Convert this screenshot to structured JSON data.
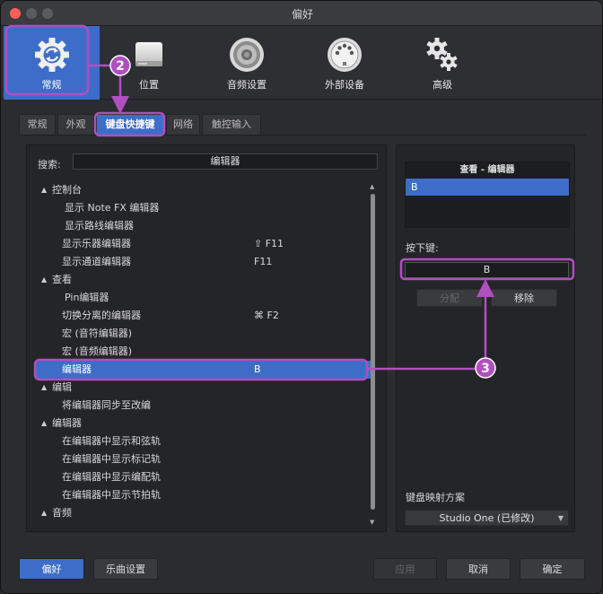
{
  "window": {
    "title": "偏好"
  },
  "toolbar": {
    "items": [
      {
        "label": "常规",
        "icon": "gear-refresh-icon",
        "active": true
      },
      {
        "label": "位置",
        "icon": "drive-icon"
      },
      {
        "label": "音频设置",
        "icon": "speaker-icon"
      },
      {
        "label": "外部设备",
        "icon": "midi-port-icon"
      },
      {
        "label": "高级",
        "icon": "gears-icon"
      }
    ]
  },
  "tabs": [
    {
      "label": "常规"
    },
    {
      "label": "外观"
    },
    {
      "label": "键盘快捷键",
      "active": true
    },
    {
      "label": "网络"
    },
    {
      "label": "触控输入"
    }
  ],
  "search": {
    "label": "搜索:",
    "value": "编辑器"
  },
  "tree": [
    {
      "level": 0,
      "label": "控制台",
      "expanded": true
    },
    {
      "level": 2,
      "label": "显示 Note FX 编辑器",
      "key": ""
    },
    {
      "level": 2,
      "label": "显示路线编辑器",
      "key": ""
    },
    {
      "level": 1,
      "label": "显示乐器编辑器",
      "key": "⇧ F11"
    },
    {
      "level": 1,
      "label": "显示通道编辑器",
      "key": "F11"
    },
    {
      "level": 0,
      "label": "查看",
      "expanded": true
    },
    {
      "level": 2,
      "label": "Pin编辑器",
      "key": ""
    },
    {
      "level": 1,
      "label": "切换分离的编辑器",
      "key": "⌘ F2"
    },
    {
      "level": 1,
      "label": "宏 (音符编辑器)",
      "key": ""
    },
    {
      "level": 1,
      "label": "宏 (音频编辑器)",
      "key": ""
    },
    {
      "level": 1,
      "label": "编辑器",
      "key": "B",
      "selected": true
    },
    {
      "level": 0,
      "label": "编辑",
      "expanded": true
    },
    {
      "level": 1,
      "label": "将编辑器同步至改编",
      "key": ""
    },
    {
      "level": 0,
      "label": "编辑器",
      "expanded": true
    },
    {
      "level": 1,
      "label": "在编辑器中显示和弦轨",
      "key": ""
    },
    {
      "level": 1,
      "label": "在编辑器中显示标记轨",
      "key": ""
    },
    {
      "level": 1,
      "label": "在编辑器中显示编配轨",
      "key": ""
    },
    {
      "level": 1,
      "label": "在编辑器中显示节拍轨",
      "key": ""
    },
    {
      "level": 0,
      "label": "音频",
      "expanded": true
    }
  ],
  "right_panel": {
    "assigned_header": "查看 - 编辑器",
    "assigned_keys": [
      "B"
    ],
    "press_label": "按下键:",
    "press_value": "B",
    "assign_label": "分配",
    "remove_label": "移除",
    "scheme_label": "键盘映射方案",
    "scheme_value": "Studio One (已修改)"
  },
  "bottom": {
    "prefs_label": "偏好",
    "song_settings_label": "乐曲设置",
    "apply_label": "应用",
    "cancel_label": "取消",
    "ok_label": "确定"
  },
  "annotations": {
    "step2": "2",
    "step3": "3"
  },
  "colors": {
    "accent": "#3d6dc8",
    "annotation": "#b04fc0"
  }
}
